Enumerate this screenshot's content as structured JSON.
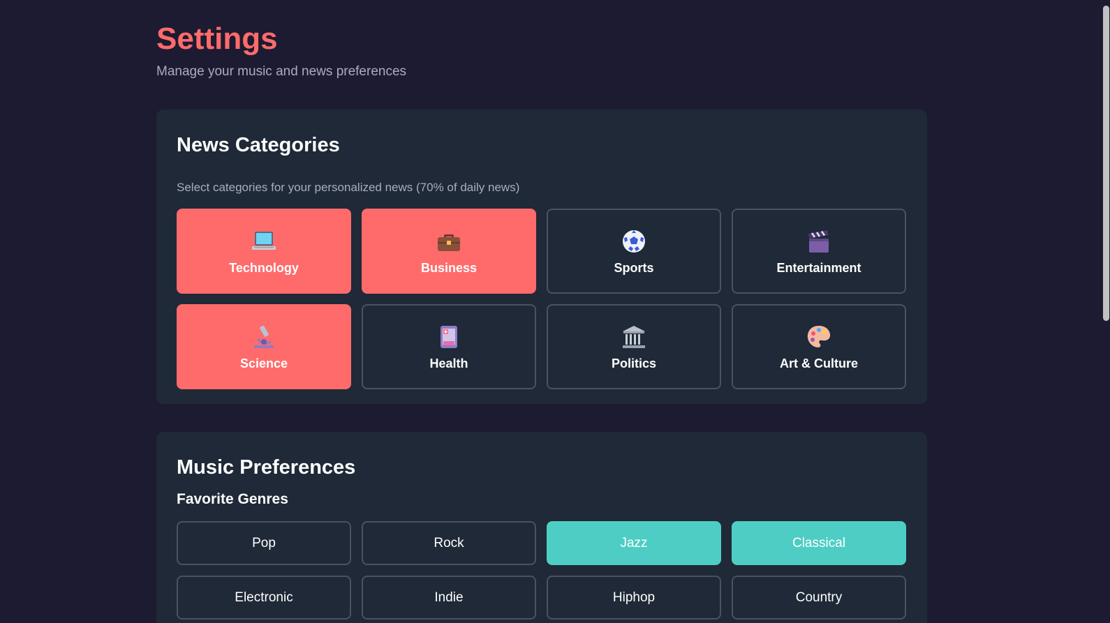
{
  "header": {
    "title": "Settings",
    "subtitle": "Manage your music and news preferences"
  },
  "news": {
    "title": "News Categories",
    "description": "Select categories for your personalized news (70% of daily news)",
    "categories": [
      {
        "label": "Technology",
        "icon": "laptop-icon",
        "selected": true
      },
      {
        "label": "Business",
        "icon": "briefcase-icon",
        "selected": true
      },
      {
        "label": "Sports",
        "icon": "soccer-ball-icon",
        "selected": false
      },
      {
        "label": "Entertainment",
        "icon": "clapperboard-icon",
        "selected": false
      },
      {
        "label": "Science",
        "icon": "microscope-icon",
        "selected": true
      },
      {
        "label": "Health",
        "icon": "medical-clipboard-icon",
        "selected": false
      },
      {
        "label": "Politics",
        "icon": "government-building-icon",
        "selected": false
      },
      {
        "label": "Art & Culture",
        "icon": "artist-palette-icon",
        "selected": false
      }
    ]
  },
  "music": {
    "title": "Music Preferences",
    "genres_title": "Favorite Genres",
    "genres": [
      {
        "label": "Pop",
        "selected": false
      },
      {
        "label": "Rock",
        "selected": false
      },
      {
        "label": "Jazz",
        "selected": true
      },
      {
        "label": "Classical",
        "selected": true
      },
      {
        "label": "Electronic",
        "selected": false
      },
      {
        "label": "Indie",
        "selected": false
      },
      {
        "label": "Hiphop",
        "selected": false
      },
      {
        "label": "Country",
        "selected": false
      }
    ]
  },
  "colors": {
    "background": "#1c1b31",
    "card": "#1f2937",
    "accent_news": "#ff6b6b",
    "accent_music": "#4ecdc4",
    "muted_text": "#a9adc1",
    "border": "#4a5263"
  }
}
